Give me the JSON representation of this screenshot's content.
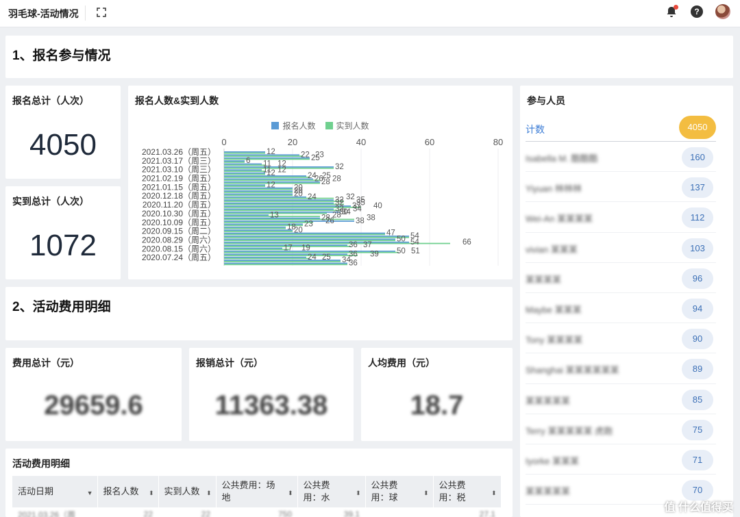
{
  "header": {
    "title": "羽毛球-活动情况"
  },
  "section1": {
    "title": "1、报名参与情况"
  },
  "stats1": {
    "signup_total_label": "报名总计（人次）",
    "signup_total_value": "4050",
    "attend_total_label": "实到总计（人次）",
    "attend_total_value": "1072"
  },
  "chart": {
    "title": "报名人数&实到人数"
  },
  "chart_data": {
    "type": "bar",
    "orientation": "horizontal",
    "title": "报名人数&实到人数",
    "xlim": [
      0,
      80
    ],
    "xticks": [
      0,
      20,
      40,
      60,
      80
    ],
    "legend_position": "top",
    "series": [
      {
        "name": "报名人数",
        "color": "#5b9bd5"
      },
      {
        "name": "实到人数",
        "color": "#70d08f"
      }
    ],
    "category_labels": [
      "2021.03.26（周五）",
      "2021.03.17（周三）",
      "2021.03.10（周三）",
      "2021.02.19（周五）",
      "2021.01.15（周五）",
      "2020.12.18（周五）",
      "2020.11.20（周五）",
      "2020.10.30（周五）",
      "2020.10.09（周五）",
      "2020.09.15（周二）",
      "2020.08.29（周六）",
      "2020.08.15（周六）",
      "2020.07.24（周五）"
    ],
    "bar_values": [
      {
        "signup": 12,
        "attend": 12
      },
      {
        "signup": 22,
        "attend": 23
      },
      {
        "signup": 25,
        "attend": 25
      },
      {
        "signup": 6,
        "attend": 6
      },
      {
        "signup": 11,
        "attend": 12
      },
      {
        "signup": 32,
        "attend": 32
      },
      {
        "signup": 11,
        "attend": 12
      },
      {
        "signup": 12,
        "attend": 12
      },
      {
        "signup": 24,
        "attend": 25
      },
      {
        "signup": 26,
        "attend": 28
      },
      {
        "signup": 28,
        "attend": 28
      },
      {
        "signup": 12,
        "attend": 12
      },
      {
        "signup": 20,
        "attend": 20
      },
      {
        "signup": 20,
        "attend": 20
      },
      {
        "signup": 20,
        "attend": 20
      },
      {
        "signup": 24,
        "attend": 32
      },
      {
        "signup": 32,
        "attend": 35
      },
      {
        "signup": 32,
        "attend": 35
      },
      {
        "signup": 37,
        "attend": 40
      },
      {
        "signup": 32,
        "attend": 34
      },
      {
        "signup": 34,
        "attend": 30
      },
      {
        "signup": 13,
        "attend": 28
      },
      {
        "signup": 28,
        "attend": 38
      },
      {
        "signup": 38,
        "attend": 26
      },
      {
        "signup": 23,
        "attend": 23
      },
      {
        "signup": 18,
        "attend": 18
      },
      {
        "signup": 20,
        "attend": 20
      },
      {
        "signup": 47,
        "attend": 47
      },
      {
        "signup": 54,
        "attend": 54
      },
      {
        "signup": 50,
        "attend": 50
      },
      {
        "signup": 54,
        "attend": 66
      },
      {
        "signup": 36,
        "attend": 37
      },
      {
        "signup": 17,
        "attend": 19
      },
      {
        "signup": 50,
        "attend": 51
      },
      {
        "signup": 36,
        "attend": 39
      },
      {
        "signup": 24,
        "attend": 25
      },
      {
        "signup": 34,
        "attend": 34
      },
      {
        "signup": 36,
        "attend": 36
      }
    ]
  },
  "section2": {
    "title": "2、活动费用明细"
  },
  "stats2": {
    "fee_total_label": "费用总计（元）",
    "fee_total_value": "29659.6",
    "reimb_total_label": "报销总计（元）",
    "reimb_total_value": "11363.38",
    "per_capita_label": "人均费用（元）",
    "per_capita_value": "18.7"
  },
  "fee_table": {
    "title": "活动费用明细",
    "columns": [
      "活动日期",
      "报名人数",
      "实到人数",
      "公共费用：场地",
      "公共费用：水",
      "公共费用：球",
      "公共费用：税"
    ],
    "first_row": [
      "2021.03.26（周",
      "22",
      "22",
      "750",
      "39.1",
      "",
      "27.1"
    ]
  },
  "people": {
    "title": "参与人员",
    "count_label": "计数",
    "count_total": "4050",
    "rows": [
      {
        "name": "Isabella M. 酷酷酷",
        "count": "160"
      },
      {
        "name": "Yiyuan 林林林",
        "count": "137"
      },
      {
        "name": "Wei-An 某某某某",
        "count": "112"
      },
      {
        "name": "vivian 某某某",
        "count": "103"
      },
      {
        "name": "某某某某",
        "count": "96"
      },
      {
        "name": "Maybe 某某某",
        "count": "94"
      },
      {
        "name": "Tony 某某某某",
        "count": "90"
      },
      {
        "name": "Shanghai 某某某某某某",
        "count": "89"
      },
      {
        "name": "某某某某某",
        "count": "85"
      },
      {
        "name": "Terry 某某某某某 虎跑",
        "count": "75"
      },
      {
        "name": "Iyorke 某某某",
        "count": "71"
      },
      {
        "name": "某某某某某",
        "count": "70"
      }
    ]
  },
  "branding": {
    "text": "值 什么值得买"
  }
}
